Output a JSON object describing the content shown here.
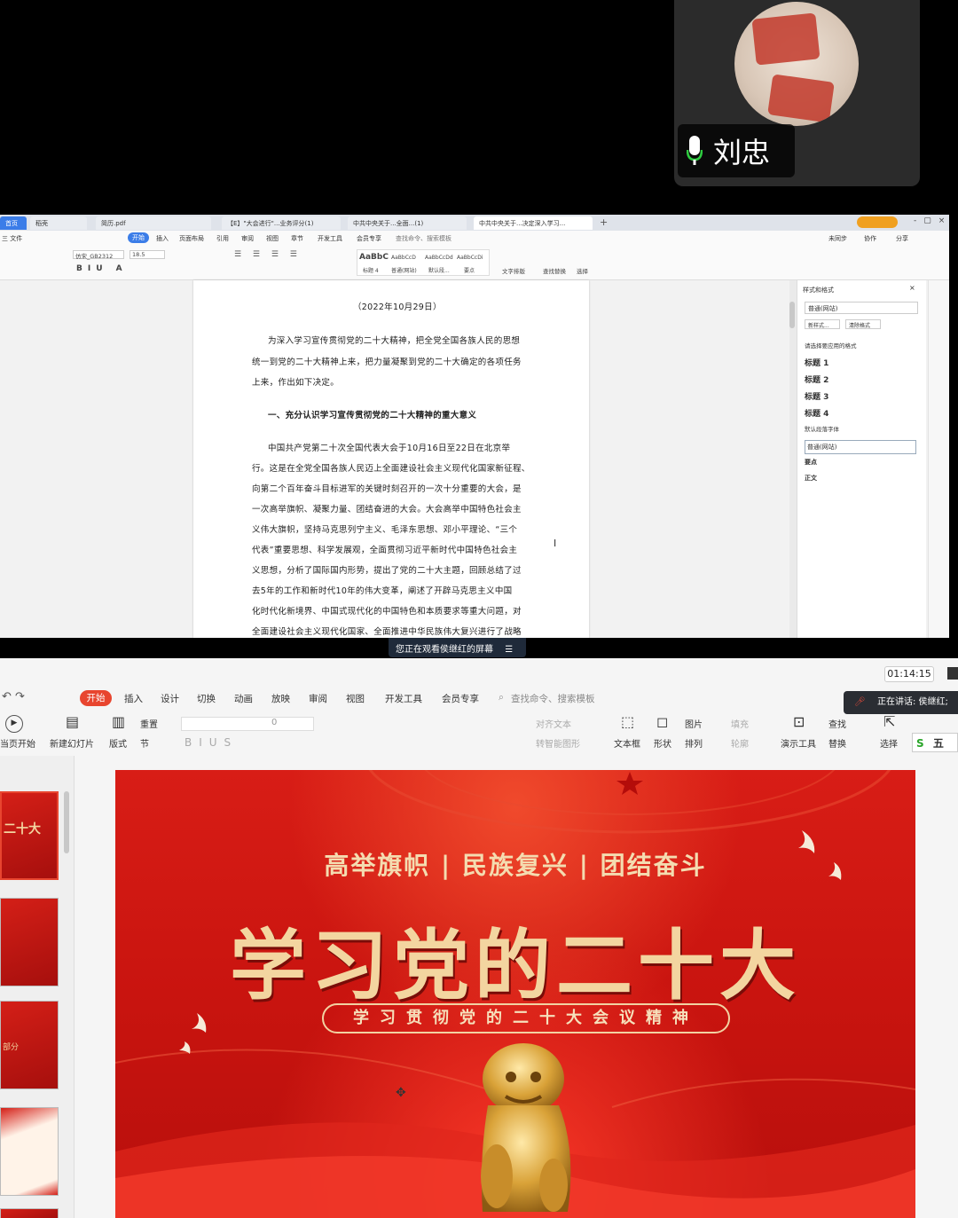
{
  "meeting": {
    "speaker_name": "刘忠",
    "sharing_banner": "您正在观看侯继红的屏幕",
    "speaking_indicator": "正在讲话: 侯继红;",
    "elapsed_time": "01:14:15"
  },
  "writer": {
    "tabs": [
      "首页",
      "稻壳",
      "简历.pdf",
      "【E】\"大会进行\"...业务评分(1)",
      "中共中央关于...全面...(1)",
      "中共中央关于...决定深入学习..."
    ],
    "menu": [
      "三 文件",
      "开始",
      "插入",
      "页面布局",
      "引用",
      "审阅",
      "视图",
      "章节",
      "开发工具",
      "会员专享",
      "查找命令、搜索模板"
    ],
    "menu_right": [
      "未同步",
      "协作",
      "分享"
    ],
    "font_name": "仿宋_GB2312",
    "font_size": "18.5",
    "style_gallery": [
      "AaBbC",
      "AaBbCcD",
      "AaBbCcDd",
      "AaBbCcDi"
    ],
    "style_gallery_labels": [
      "标题 4",
      "普通(网站)",
      "默认段...",
      "要点"
    ],
    "ribbon_right": [
      "文字排版",
      "查找替换",
      "选择"
    ],
    "doc_lines": [
      "（2022年10月29日）",
      "为深入学习宣传贯彻党的二十大精神，把全党全国各族人民的思想",
      "统一到党的二十大精神上来，把力量凝聚到党的二十大确定的各项任务",
      "上来，作出如下决定。",
      "一、充分认识学习宣传贯彻党的二十大精神的重大意义",
      "中国共产党第二十次全国代表大会于10月16日至22日在北京举",
      "行。这是在全党全国各族人民迈上全面建设社会主义现代化国家新征程、",
      "向第二个百年奋斗目标进军的关键时刻召开的一次十分重要的大会，是",
      "一次高举旗帜、凝聚力量、团结奋进的大会。大会高举中国特色社会主",
      "义伟大旗帜，坚持马克思列宁主义、毛泽东思想、邓小平理论、“三个",
      "代表”重要思想、科学发展观，全面贯彻习近平新时代中国特色社会主",
      "义思想，分析了国际国内形势，提出了党的二十大主题，回顾总结了过",
      "去5年的工作和新时代10年的伟大变革，阐述了开辟马克思主义中国",
      "化时代化新境界、中国式现代化的中国特色和本质要求等重大问题，对",
      "全面建设社会主义现代化国家、全面推进中华民族伟大复兴进行了战略"
    ],
    "styles_pane": {
      "title": "样式和格式",
      "current_style": "普通(网站)",
      "new_style_button": "新样式...",
      "clear_button": "清除格式",
      "apply_label": "请选择要应用的格式",
      "items": [
        "标题 1",
        "标题 2",
        "标题 3",
        "标题 4",
        "默认段落字体",
        "普通(网站)",
        "要点",
        "正文"
      ]
    }
  },
  "presentation": {
    "menu": [
      "开始",
      "插入",
      "设计",
      "切换",
      "动画",
      "放映",
      "审阅",
      "视图",
      "开发工具",
      "会员专享"
    ],
    "search_placeholder": "查找命令、搜索模板",
    "ribbon": {
      "from_start": "当页开始",
      "new_slide": "新建幻灯片",
      "layout": "版式",
      "reset": "重置",
      "section": "节",
      "font_size": "0",
      "align_text": "对齐文本",
      "smartart": "转智能图形",
      "textbox": "文本框",
      "shape": "形状",
      "picture": "图片",
      "arrange": "排列",
      "fill": "填充",
      "outline": "轮廓",
      "presenter_tools": "演示工具",
      "find": "查找",
      "replace": "替换",
      "select": "选择",
      "wubi": "五"
    },
    "thumb_texts": [
      "二十大",
      "部分"
    ],
    "slide": {
      "subtitle": "高举旗帜 | 民族复兴 | 团结奋斗",
      "title": "学习党的二十大",
      "pill_text": "学习贯彻党的二十大会议精神"
    }
  },
  "colors": {
    "slide_red": "#c9140f",
    "accent_orange": "#e8452f",
    "gold_text": "#f3d5a0"
  }
}
